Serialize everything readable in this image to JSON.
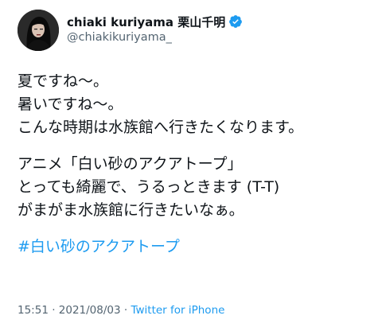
{
  "author": {
    "display_name": "chiaki kuriyama 栗山千明",
    "handle": "@chiakikuriyama_",
    "verified": true
  },
  "tweet": {
    "paragraphs": [
      [
        "夏ですね〜。",
        "暑いですね〜。",
        "こんな時期は水族館へ行きたくなります。"
      ],
      [
        "アニメ「白い砂のアクアトープ」",
        "とっても綺麗で、うるっときます (T-T)",
        "がまがま水族館に行きたいなぁ。"
      ]
    ],
    "hashtag": "#白い砂のアクアトープ"
  },
  "meta": {
    "time": "15:51",
    "separator1": " · ",
    "date": "2021/08/03",
    "separator2": " · ",
    "source": "Twitter for iPhone"
  },
  "colors": {
    "accent": "#1d9bf0",
    "text": "#0f1419",
    "secondary": "#536471"
  }
}
